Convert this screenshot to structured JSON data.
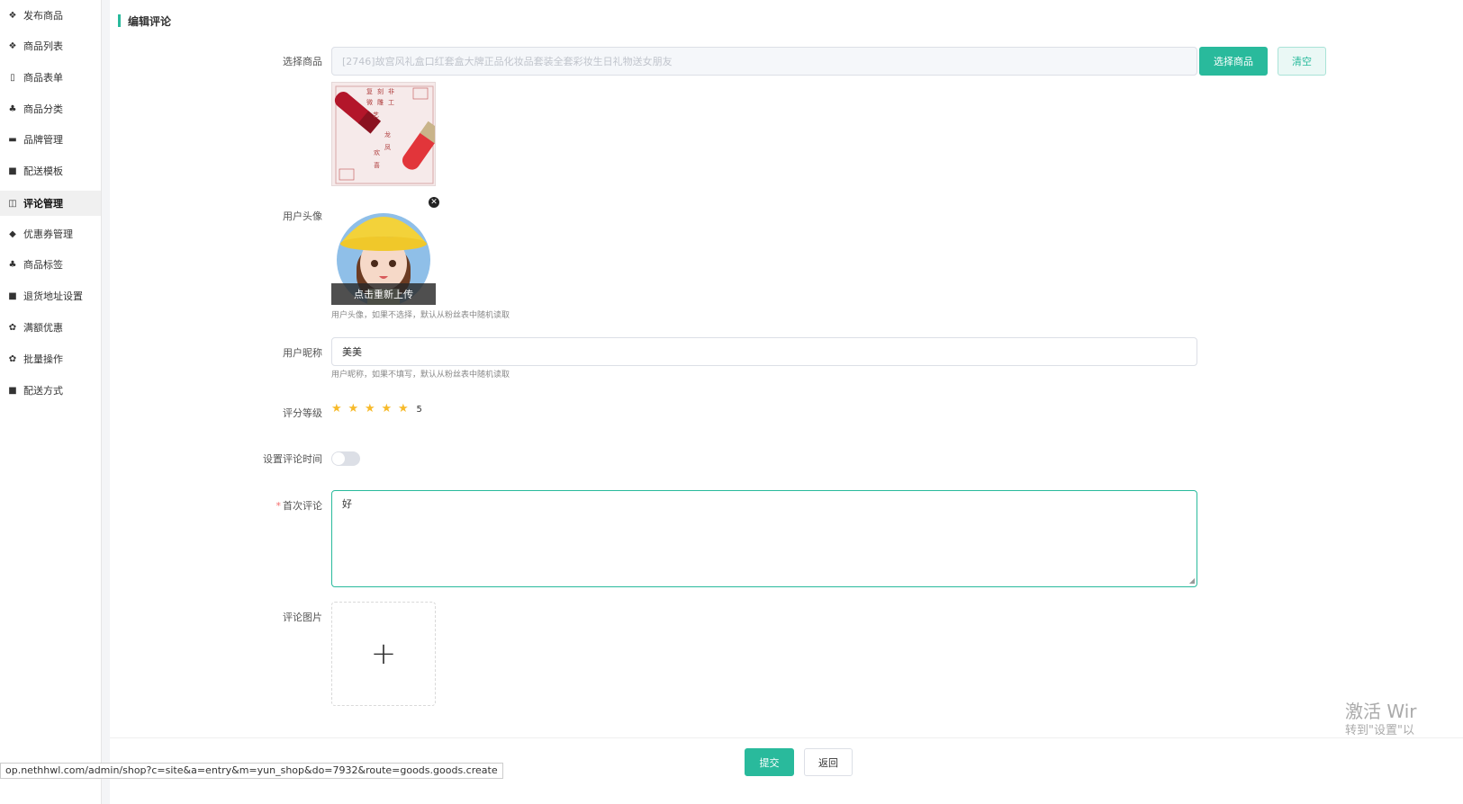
{
  "sidebar": {
    "items": [
      {
        "label": "发布商品",
        "icon": "cubes-icon"
      },
      {
        "label": "商品列表",
        "icon": "cubes-icon"
      },
      {
        "label": "商品表单",
        "icon": "file-icon"
      },
      {
        "label": "商品分类",
        "icon": "sitemap-icon"
      },
      {
        "label": "品牌管理",
        "icon": "briefcase-icon"
      },
      {
        "label": "配送模板",
        "icon": "truck-icon"
      },
      {
        "label": "评论管理",
        "icon": "columns-icon",
        "active": true
      },
      {
        "label": "优惠券管理",
        "icon": "tags-icon"
      },
      {
        "label": "商品标签",
        "icon": "sitemap-icon"
      },
      {
        "label": "退货地址设置",
        "icon": "truck-icon"
      },
      {
        "label": "满额优惠",
        "icon": "gift-icon"
      },
      {
        "label": "批量操作",
        "icon": "gift-icon"
      },
      {
        "label": "配送方式",
        "icon": "truck-icon"
      }
    ]
  },
  "page": {
    "title": "编辑评论"
  },
  "form": {
    "product": {
      "label": "选择商品",
      "value": "[2746]故宫风礼盒口红套盒大牌正品化妆品套装全套彩妆生日礼物送女朋友",
      "select_btn": "选择商品",
      "clear_btn": "清空"
    },
    "avatar": {
      "label": "用户头像",
      "reupload": "点击重新上传",
      "hint": "用户头像，如果不选择，默认从粉丝表中随机读取"
    },
    "nickname": {
      "label": "用户昵称",
      "value": "美美",
      "hint": "用户昵称，如果不填写，默认从粉丝表中随机读取"
    },
    "rating": {
      "label": "评分等级",
      "value": 5,
      "max": 5,
      "display": "5"
    },
    "time_toggle": {
      "label": "设置评论时间",
      "on": false
    },
    "first_comment": {
      "required_mark": "*",
      "label": "首次评论",
      "value": "好"
    },
    "images": {
      "label": "评论图片",
      "add_symbol": "+"
    }
  },
  "footer": {
    "submit": "提交",
    "back": "返回"
  },
  "watermark": {
    "line1": "激活 Wir",
    "line2": "转到\"设置\"以"
  },
  "statusbar": {
    "url": "op.nethhwl.com/admin/shop?c=site&a=entry&m=yun_shop&do=7932&route=goods.goods.create"
  },
  "colors": {
    "accent": "#29ba9c",
    "star": "#f7ba2a",
    "required": "#f56c6c"
  }
}
